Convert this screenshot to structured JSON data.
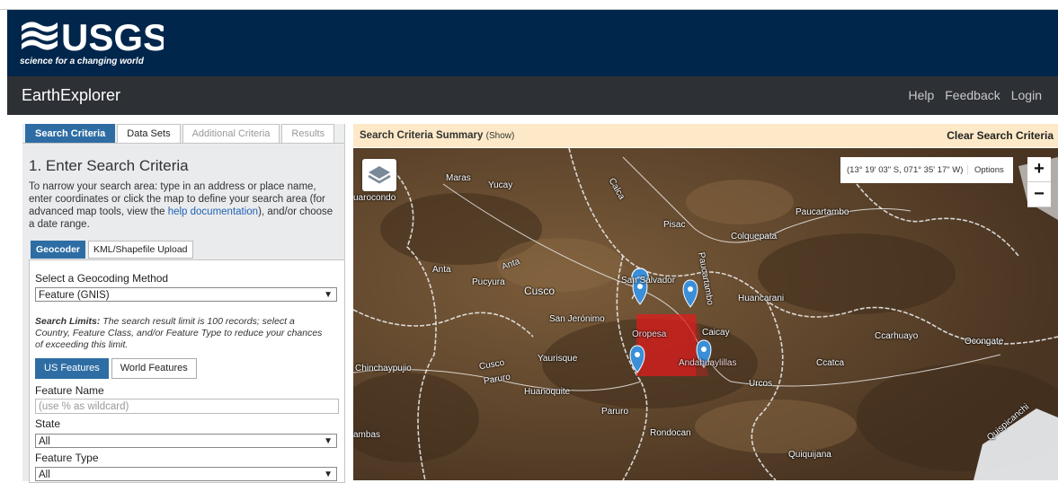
{
  "brand": {
    "logo_text": "USGS",
    "tagline": "science for a changing world"
  },
  "app": {
    "title": "EarthExplorer",
    "nav": [
      "Help",
      "Feedback",
      "Login"
    ]
  },
  "left_tabs": [
    "Search Criteria",
    "Data Sets",
    "Additional Criteria",
    "Results"
  ],
  "criteria": {
    "heading": "1. Enter Search Criteria",
    "intro_a": "To narrow your search area: type in an address or place name, enter coordinates or click the map to define your search area (for advanced map tools, view the ",
    "intro_link": "help documentation",
    "intro_b": "), and/or choose a date range."
  },
  "sub_tabs": [
    "Geocoder",
    "KML/Shapefile Upload"
  ],
  "geocoder": {
    "method_label": "Select a Geocoding Method",
    "method_value": "Feature (GNIS)",
    "limits_title": "Search Limits:",
    "limits_text": " The search result limit is 100 records; select a Country, Feature Class, and/or Feature Type to reduce your chances of exceeding this limit.",
    "feature_buttons": [
      "US Features",
      "World Features"
    ],
    "feature_name_label": "Feature Name",
    "feature_name_placeholder": "(use % as wildcard)",
    "state_label": "State",
    "state_value": "All",
    "feature_type_label": "Feature Type",
    "feature_type_value": "All"
  },
  "map_header": {
    "title": "Search Criteria Summary",
    "show": "(Show)",
    "clear": "Clear Search Criteria"
  },
  "map": {
    "coordinates": "(13° 19' 03\" S, 071° 35' 17\" W)",
    "options": "Options",
    "zoom_in": "+",
    "zoom_out": "−",
    "labels": [
      "Maras",
      "Yucay",
      "uarocondo",
      "Calca",
      "Pisac",
      "Paucartambo",
      "Colquepata",
      "Anta",
      "Anta",
      "Pucyura",
      "Cusco",
      "San Salvador",
      "Paucartambo",
      "Huancarani",
      "San Jerónimo",
      "Oropesa",
      "Caicay",
      "Ccarhuayo",
      "Ocongate",
      "Chinchaypujio",
      "Cusco",
      "Paruro",
      "Yaurisque",
      "Andahuaylillas",
      "Ccatca",
      "Urcos",
      "Huanoquite",
      "Paruro",
      "Rondocan",
      "ambas",
      "Quiquijana",
      "Quispicanchi"
    ],
    "accent": "#e11d1d"
  }
}
